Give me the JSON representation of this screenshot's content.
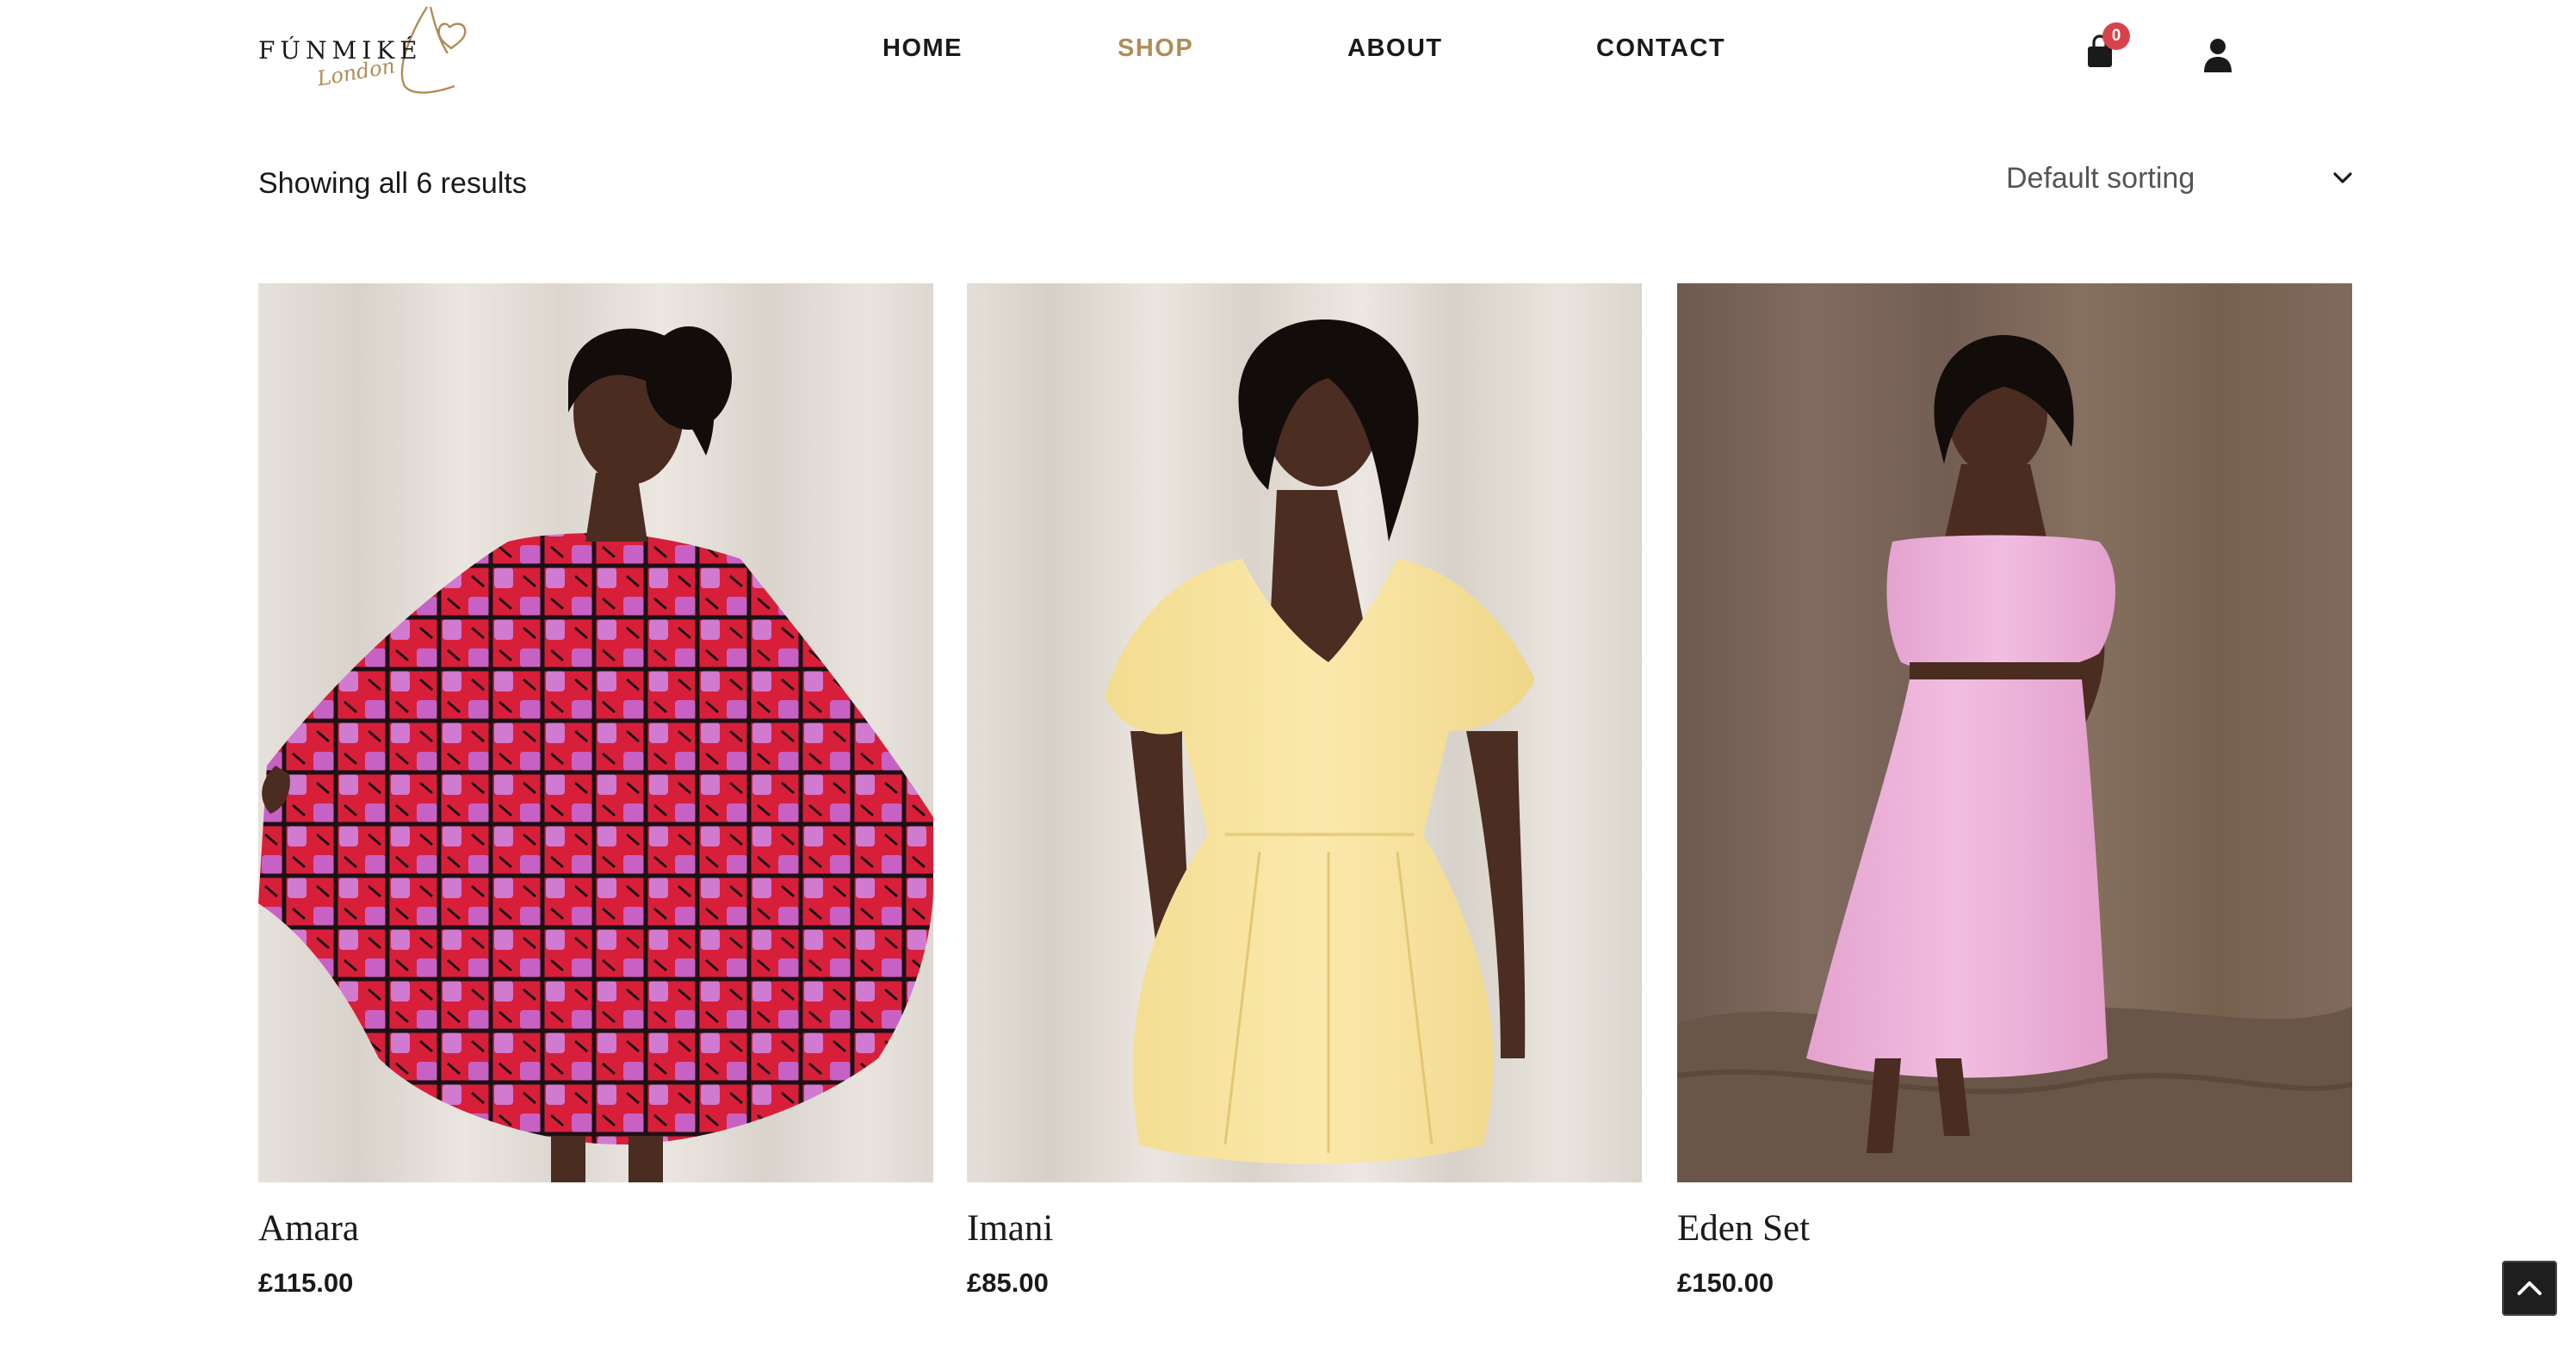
{
  "logo": {
    "text": "FÚNMIKÉ",
    "script": "London"
  },
  "nav": {
    "items": [
      {
        "label": "HOME"
      },
      {
        "label": "SHOP",
        "active": true
      },
      {
        "label": "ABOUT"
      },
      {
        "label": "CONTACT"
      }
    ]
  },
  "cart": {
    "count": "0",
    "icon": "shopping-bag-icon"
  },
  "user": {
    "icon": "user-icon"
  },
  "toolbar": {
    "result_count": "Showing all 6 results",
    "sorting_selected": "Default sorting",
    "sorting_icon": "chevron-down-icon"
  },
  "products": [
    {
      "name": "Amara",
      "price": "£115.00"
    },
    {
      "name": "Imani",
      "price": "£85.00"
    },
    {
      "name": "Eden Set",
      "price": "£150.00"
    }
  ],
  "back_to_top": {
    "icon": "chevron-up-icon"
  },
  "colors": {
    "accent": "#b08d57",
    "badge": "#d8434a",
    "text": "#1a1a1a"
  }
}
